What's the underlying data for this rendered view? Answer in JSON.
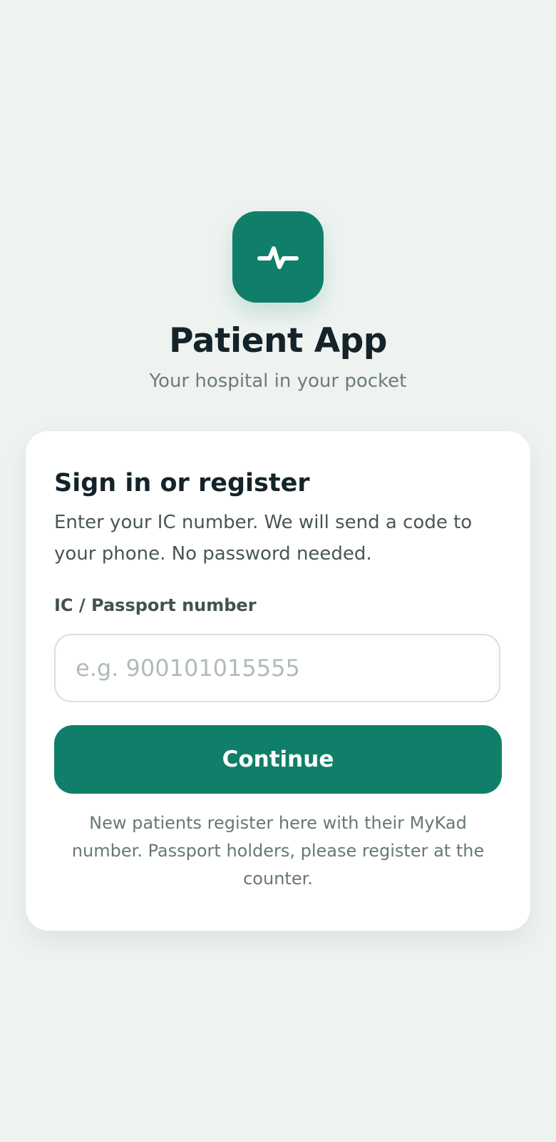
{
  "app": {
    "title": "Patient App",
    "subtitle": "Your hospital in your pocket",
    "logo_icon": "pulse-icon"
  },
  "signin": {
    "title": "Sign in or register",
    "description": "Enter your IC number. We will send a code to your phone. No password needed.",
    "field_label": "IC / Passport number",
    "input_placeholder": "e.g. 900101015555",
    "input_value": "",
    "continue_label": "Continue",
    "note": "New patients register here with their MyKad number. Passport holders, please register at the counter."
  },
  "colors": {
    "background": "#eef3f0",
    "brand": "#0f7f69",
    "card": "#ffffff",
    "title_text": "#142329",
    "muted_text": "#6b7d7b"
  }
}
